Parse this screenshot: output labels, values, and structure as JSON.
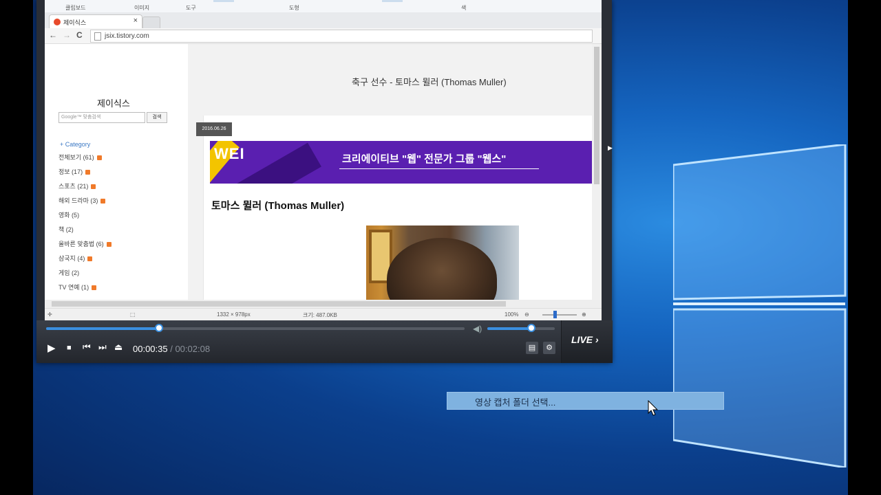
{
  "ribbon": {
    "groups": [
      "클립보드",
      "이미지",
      "도구",
      "도형",
      "색"
    ]
  },
  "browser": {
    "tab_title": "제이식스",
    "tab_close": "×",
    "nav_back": "←",
    "nav_forward": "→",
    "nav_reload": "C",
    "url": "jsix.tistory.com"
  },
  "blog": {
    "title": "제이식스",
    "search_placeholder": "Google™ 맞춤검색",
    "search_button": "검색",
    "category_header": "+ Category",
    "categories": [
      {
        "label": "전체보기 (61)",
        "rss": true
      },
      {
        "label": "정보 (17)",
        "rss": true
      },
      {
        "label": "스포츠 (21)",
        "rss": true
      },
      {
        "label": "해외 드라마 (3)",
        "rss": true
      },
      {
        "label": "영화 (5)",
        "rss": false
      },
      {
        "label": "책 (2)",
        "rss": false
      },
      {
        "label": "올바른 맞춤법 (6)",
        "rss": true
      },
      {
        "label": "삼국지 (4)",
        "rss": true
      },
      {
        "label": "게임 (2)",
        "rss": false
      },
      {
        "label": "TV 연예 (1)",
        "rss": true
      }
    ],
    "post_title": "축구 선수 - 토마스 뮐러 (Thomas Muller)",
    "post_date": "2016.06.26",
    "banner_logo": "WEI",
    "banner_slogan": "크리에이티브 \"웹\" 전문가 그룹 \"웹스\"",
    "article_heading": "토마스 뮐러 (Thomas Muller)"
  },
  "status_bar": {
    "dimensions": "1332 × 978px",
    "size": "크기: 487.0KB",
    "zoom": "100%"
  },
  "player": {
    "current_time": "00:00:35",
    "separator": " / ",
    "duration": "00:00:02:08",
    "duration_display": "00:02:08",
    "progress": 0.27,
    "volume": 0.65,
    "live_label": "LIVE",
    "play": "▶",
    "stop": "■",
    "prev": "⏮",
    "next": "⏭",
    "eject": "⏏",
    "playlist": "▤",
    "settings": "⚙"
  },
  "desktop": {
    "folder_tooltip": "영상 캡처 폴더 선택..."
  },
  "colors": {
    "accent": "#3a8fe0",
    "desktop": "#1565c0",
    "banner": "#5a1fb0"
  }
}
